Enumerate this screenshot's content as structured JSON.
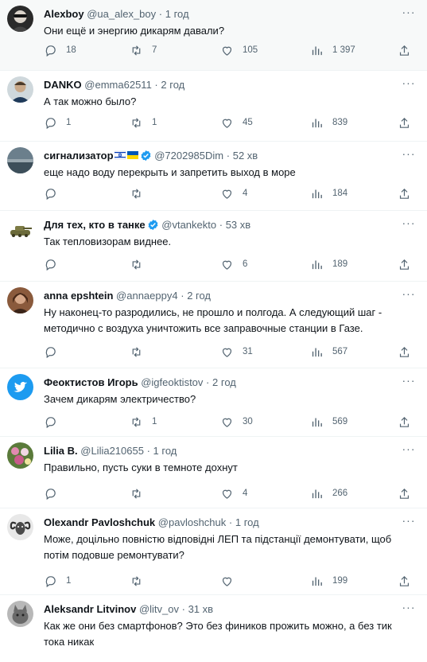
{
  "tweets": [
    {
      "name": "Alexboy",
      "handle": "@ua_alex_boy",
      "time": "1 год",
      "text": "Они ещё и энергию дикарям давали?",
      "replies": "18",
      "retweets": "7",
      "likes": "105",
      "views": "1 397",
      "avatar": "avatar-dark-sunglasses",
      "verified": false,
      "flag": ""
    },
    {
      "name": "DANKO",
      "handle": "@emma62511",
      "time": "2 год",
      "text": "А так можно было?",
      "replies": "1",
      "retweets": "1",
      "likes": "45",
      "views": "839",
      "avatar": "avatar-portrait",
      "verified": false,
      "flag": ""
    },
    {
      "name": "сигнализатор",
      "handle": "@7202985Dim",
      "time": "52 хв",
      "text": "еще надо воду перекрыть и запретить выход в море",
      "replies": "",
      "retweets": "",
      "likes": "4",
      "views": "184",
      "avatar": "avatar-landscape",
      "verified": true,
      "flag": "israel-ukraine-flags"
    },
    {
      "name": "Для тех, кто в танке",
      "handle": "@vtankekto",
      "time": "53 хв",
      "text": "Так тепловизорам виднее.",
      "replies": "",
      "retweets": "",
      "likes": "6",
      "views": "189",
      "avatar": "avatar-tank",
      "verified": true,
      "flag": ""
    },
    {
      "name": "anna epshtein",
      "handle": "@annaeppy4",
      "time": "2 год",
      "text": "Ну наконец-то разродились, не прошло и полгода. А следующий шаг - методично с воздуха уничтожить все заправочные станции в Газе.",
      "replies": "",
      "retweets": "",
      "likes": "31",
      "views": "567",
      "avatar": "avatar-woman",
      "verified": false,
      "flag": ""
    },
    {
      "name": "Феоктистов Игорь",
      "handle": "@igfeoktistov",
      "time": "2 год",
      "text": "Зачем дикарям электричество?",
      "replies": "",
      "retweets": "1",
      "likes": "30",
      "views": "569",
      "avatar": "avatar-twitter-bird",
      "verified": false,
      "flag": ""
    },
    {
      "name": "Lilia B.",
      "handle": "@Lilia210655",
      "time": "1 год",
      "text": "Правильно, пусть суки в темноте дохнут",
      "replies": "",
      "retweets": "",
      "likes": "4",
      "views": "266",
      "avatar": "avatar-flowers",
      "verified": false,
      "flag": ""
    },
    {
      "name": "Olexandr Pavloshchuk",
      "handle": "@pavloshchuk",
      "time": "1 год",
      "text": "Може, доцільно повністю відповідні ЛЕП та підстанції демонтувати, щоб потім подовше ремонтувати?",
      "replies": "1",
      "retweets": "",
      "likes": "",
      "views": "199",
      "avatar": "avatar-ram",
      "verified": false,
      "flag": ""
    },
    {
      "name": "Aleksandr Litvinov",
      "handle": "@litv_ov",
      "time": "31 хв",
      "text": "Как же они без смартфонов? Это без фиников прожить можно, а без тик тока никак",
      "replies": "",
      "retweets": "",
      "likes": "",
      "views": "",
      "avatar": "avatar-cat",
      "verified": false,
      "flag": ""
    }
  ],
  "sep": "·",
  "more_label": "···",
  "colors": {
    "text": "#0f1419",
    "muted": "#536471",
    "verified": "#1d9bf0",
    "border": "#eff3f4",
    "highlight_bg": "#f7f9f9"
  }
}
